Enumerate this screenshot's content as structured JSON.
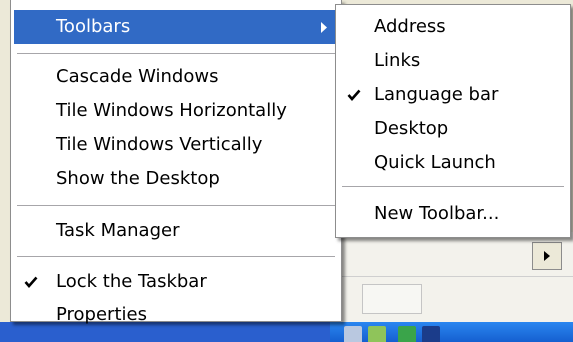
{
  "context_menu": {
    "items": [
      {
        "label": "Toolbars",
        "highlighted": true,
        "has_submenu": true
      },
      {
        "label": "Cascade Windows"
      },
      {
        "label": "Tile Windows Horizontally"
      },
      {
        "label": "Tile Windows Vertically"
      },
      {
        "label": "Show the Desktop"
      },
      {
        "label": "Task Manager"
      },
      {
        "label": "Lock the Taskbar",
        "checked": true
      },
      {
        "label": "Properties"
      }
    ]
  },
  "toolbars_submenu": {
    "items": [
      {
        "label": "Address"
      },
      {
        "label": "Links"
      },
      {
        "label": "Language bar",
        "checked": true
      },
      {
        "label": "Desktop"
      },
      {
        "label": "Quick Launch"
      },
      {
        "label": "New Toolbar..."
      }
    ]
  },
  "colors": {
    "highlight": "#316ac5",
    "menu_background": "#ffffff",
    "taskbar": "#2a5fce"
  },
  "icons": {
    "checkmark": "check-icon",
    "submenu_arrow": "chevron-right-icon",
    "scroll_right": "scroll-right-arrow-icon"
  }
}
